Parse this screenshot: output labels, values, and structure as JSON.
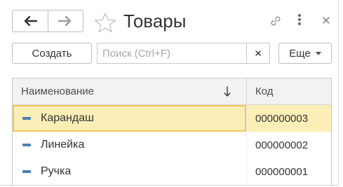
{
  "window": {
    "title": "Товары",
    "icons": {
      "back": "arrow-left-icon",
      "forward": "arrow-right-icon",
      "favorite": "star-icon",
      "link": "link-icon",
      "more": "more-vertical-icon",
      "close": "close-icon"
    }
  },
  "toolbar": {
    "create_label": "Создать",
    "search_placeholder": "Поиск (Ctrl+F)",
    "search_value": "",
    "clear_label": "×",
    "more_label": "Еще"
  },
  "table": {
    "columns": [
      "Наименование",
      "Код"
    ],
    "rows": [
      {
        "name": "Карандаш",
        "code": "000000003",
        "selected": true
      },
      {
        "name": "Линейка",
        "code": "000000002",
        "selected": false
      },
      {
        "name": "Ручка",
        "code": "000000001",
        "selected": false
      }
    ]
  },
  "colors": {
    "selected_row": "#fbeeb6",
    "selected_border": "#f2c55c",
    "row_icon": "#4a7fb5",
    "header_bg": "#f2f2f2"
  }
}
